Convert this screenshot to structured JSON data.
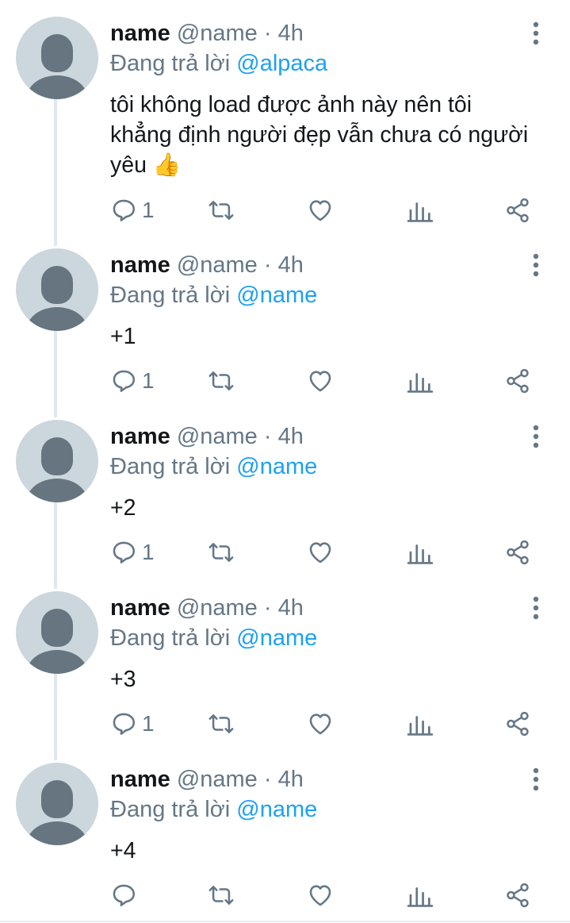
{
  "tweets": [
    {
      "name": "name",
      "handle": "@name",
      "time": "· 4h",
      "replying_prefix": "Đang trả lời",
      "replying_to": "@alpaca",
      "text": "tôi không load được ảnh này nên tôi khẳng định người đẹp vẫn chưa có người yêu 👍",
      "reply_count": "1"
    },
    {
      "name": "name",
      "handle": "@name",
      "time": "· 4h",
      "replying_prefix": "Đang trả lời",
      "replying_to": "@name",
      "text": "+1",
      "reply_count": "1"
    },
    {
      "name": "name",
      "handle": "@name",
      "time": "· 4h",
      "replying_prefix": "Đang trả lời",
      "replying_to": "@name",
      "text": "+2",
      "reply_count": "1"
    },
    {
      "name": "name",
      "handle": "@name",
      "time": "· 4h",
      "replying_prefix": "Đang trả lời",
      "replying_to": "@name",
      "text": "+3",
      "reply_count": "1"
    },
    {
      "name": "name",
      "handle": "@name",
      "time": "· 4h",
      "replying_prefix": "Đang trả lời",
      "replying_to": "@name",
      "text": "+4",
      "reply_count": ""
    }
  ],
  "icons": {
    "reply": "reply-icon",
    "retweet": "retweet-icon",
    "like": "heart-icon",
    "analytics": "analytics-icon",
    "share": "share-icon",
    "more": "more-vertical-icon"
  },
  "colors": {
    "accent": "#1da1f2",
    "text": "#14171a",
    "secondary": "#657786",
    "icon": "#657786",
    "thread_line": "#e1e8ed",
    "avatar_bg": "#ccd6dd",
    "avatar_fg": "#66757f"
  }
}
